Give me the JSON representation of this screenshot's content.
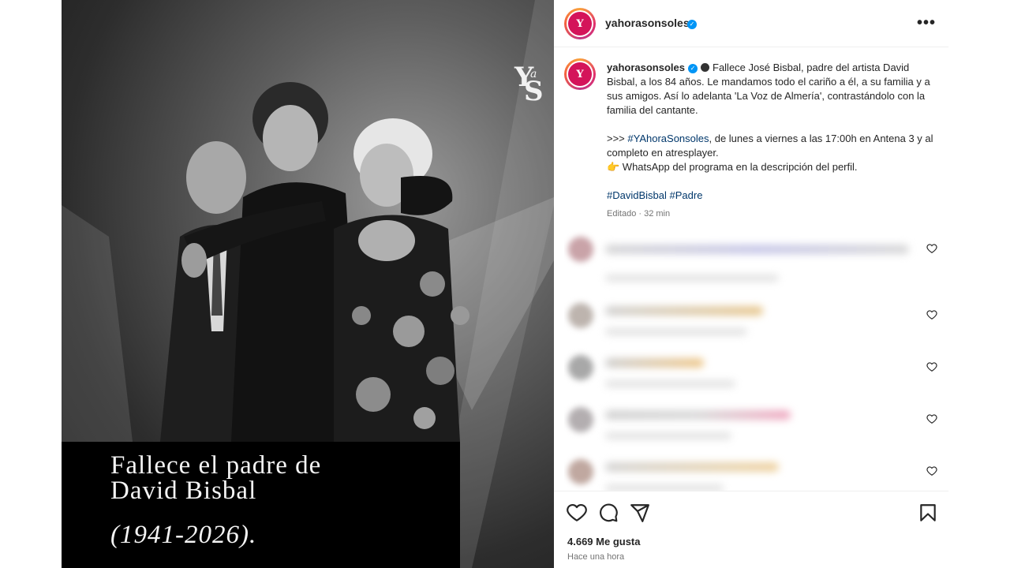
{
  "post_image": {
    "logo": {
      "y": "Y",
      "a": "a",
      "s": "S"
    },
    "title_line1": "Fallece el padre de",
    "title_line2": "David Bisbal",
    "years": "(1941-2026)."
  },
  "header": {
    "username": "yahorasonsoles",
    "more_label": "•••"
  },
  "caption": {
    "username": "yahorasonsoles",
    "paragraph1": "Fallece José Bisbal, padre del artista David Bisbal, a los 84 años. Le mandamos todo el cariño a él, a su familia y a sus amigos. Así lo adelanta 'La Voz de Almería', contrastándolo con la familia del cantante.",
    "prefix": ">>> ",
    "hashtag_show": "#YAhoraSonsoles",
    "paragraph2_rest": ", de lunes a viernes a las 17:00h en Antena 3 y al completo en atresplayer.",
    "hand_emoji": "👉",
    "paragraph3": " WhatsApp del programa en la descripción del perfil.",
    "hashtag1": "#DavidBisbal",
    "hashtag2": "#Padre",
    "edited": "Editado · 32 min"
  },
  "likes": "4.669 Me gusta",
  "time": "Hace una hora",
  "colors": {
    "accent": "#d4145a",
    "hashtag": "#00376b",
    "verified": "#0095f6"
  },
  "icons": [
    "heart-icon",
    "comment-icon",
    "share-icon",
    "bookmark-icon",
    "more-icon",
    "verified-icon"
  ]
}
